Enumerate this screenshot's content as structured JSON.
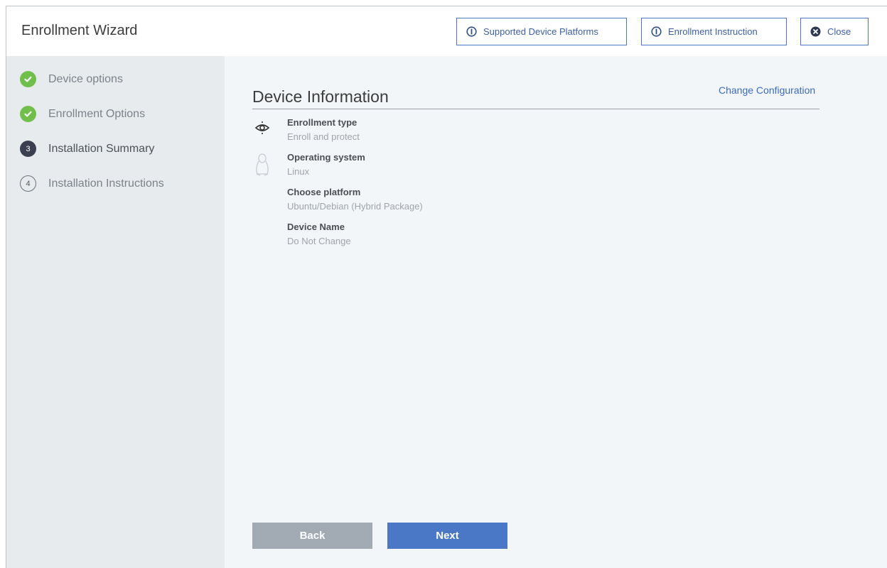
{
  "header": {
    "title": "Enrollment Wizard",
    "buttons": {
      "platforms": "Supported Device Platforms",
      "instruction": "Enrollment Instruction",
      "close": "Close"
    }
  },
  "sidebar": {
    "steps": [
      {
        "number": "",
        "label": "Device options",
        "status": "done"
      },
      {
        "number": "",
        "label": "Enrollment Options",
        "status": "done"
      },
      {
        "number": "3",
        "label": "Installation Summary",
        "status": "current"
      },
      {
        "number": "4",
        "label": "Installation Instructions",
        "status": "todo"
      }
    ]
  },
  "main": {
    "section_title": "Device Information",
    "change_link": "Change Configuration",
    "fields": [
      {
        "label": "Enrollment type",
        "value": "Enroll and protect",
        "icon": "eye-shield-icon"
      },
      {
        "label": "Operating system",
        "value": "Linux",
        "icon": "linux-penguin-icon"
      },
      {
        "label": "Choose platform",
        "value": "Ubuntu/Debian (Hybrid Package)"
      },
      {
        "label": "Device Name",
        "value": "Do Not Change"
      }
    ],
    "back_label": "Back",
    "next_label": "Next"
  },
  "colors": {
    "accent": "#4a78c7",
    "done": "#6fbf4a",
    "current": "#3a4050",
    "sidebar_bg": "#e8ebee",
    "content_bg": "#f3f6f8"
  }
}
